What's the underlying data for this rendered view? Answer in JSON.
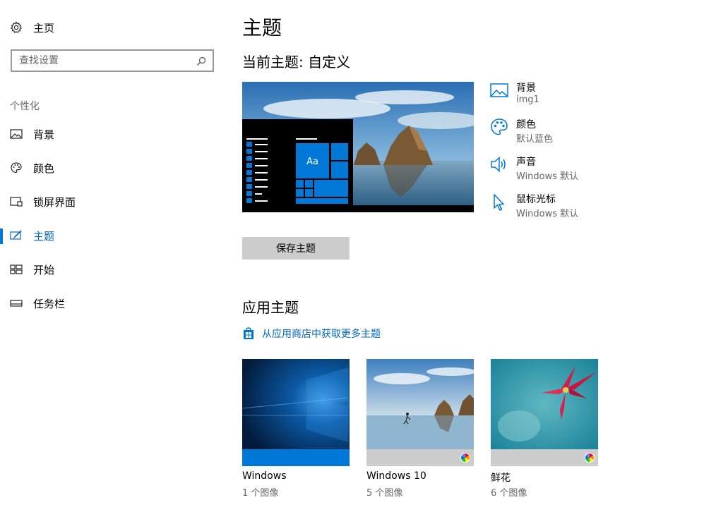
{
  "sidebar": {
    "home_label": "主页",
    "search_placeholder": "查找设置",
    "section_label": "个性化",
    "items": [
      {
        "label": "背景"
      },
      {
        "label": "颜色"
      },
      {
        "label": "锁屏界面"
      },
      {
        "label": "主题"
      },
      {
        "label": "开始"
      },
      {
        "label": "任务栏"
      }
    ]
  },
  "main": {
    "title": "主题",
    "current_theme": "当前主题: 自定义",
    "preview_tile_text": "Aa",
    "props": [
      {
        "name": "背景",
        "value": "img1",
        "icon": "picture-icon"
      },
      {
        "name": "颜色",
        "value": "默认蓝色",
        "icon": "palette-icon"
      },
      {
        "name": "声音",
        "value": "Windows 默认",
        "icon": "speaker-icon"
      },
      {
        "name": "鼠标光标",
        "value": "Windows 默认",
        "icon": "cursor-icon"
      }
    ],
    "save_button": "保存主题",
    "apply_heading": "应用主题",
    "store_link": "从应用商店中获取更多主题",
    "themes": [
      {
        "name": "Windows",
        "count": "1 个图像"
      },
      {
        "name": "Windows 10",
        "count": "5 个图像"
      },
      {
        "name": "鲜花",
        "count": "6 个图像"
      }
    ]
  },
  "colors": {
    "accent": "#0078d7",
    "link": "#0066cc",
    "secondary_text": "#666666",
    "button_bg": "#cccccc"
  }
}
